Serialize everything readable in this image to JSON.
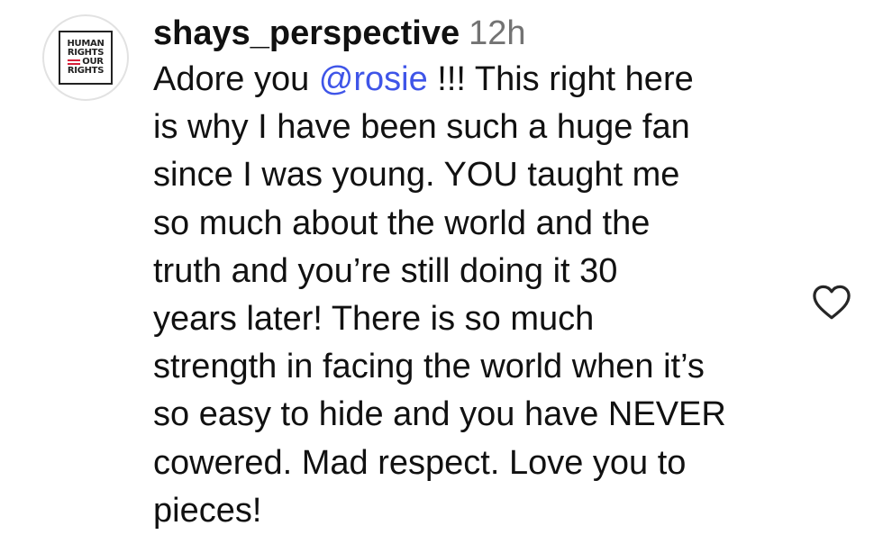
{
  "comment": {
    "avatar_logo_lines": [
      "HUMAN",
      "RIGHTS",
      "OUR",
      "RIGHTS"
    ],
    "username": "shays_perspective",
    "timestamp": "12h",
    "mention": "@rosie",
    "lines": [
      {
        "before": "Adore you ",
        "after": " !!! This right here"
      },
      "is why I have been such a huge fan",
      "since I was young. YOU taught me",
      "so much about the world and the",
      "truth and you’re still doing it 30",
      "years later! There is so much",
      "strength in facing the world when it’s",
      "so easy to hide and you have NEVER",
      "cowered. Mad respect. Love you to",
      "pieces!"
    ],
    "like_icon": "heart-icon",
    "colors": {
      "mention": "#3f55e8",
      "timestamp": "#737373",
      "text": "#111111",
      "logo_accent": "#d61f3a"
    }
  }
}
